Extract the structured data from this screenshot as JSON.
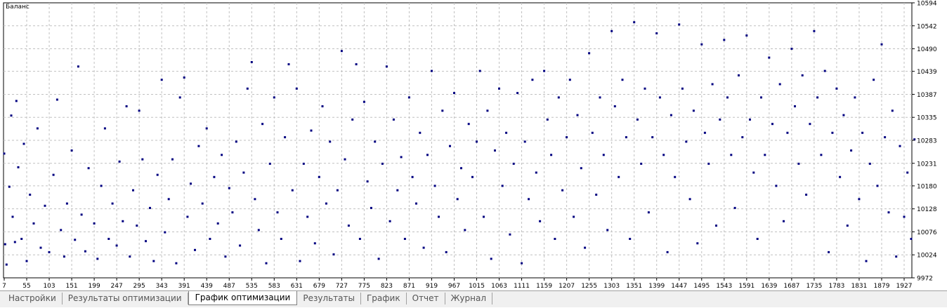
{
  "tabs": [
    {
      "label": "Настройки",
      "active": false
    },
    {
      "label": "Результаты оптимизации",
      "active": false
    },
    {
      "label": "График оптимизации",
      "active": true
    },
    {
      "label": "Результаты",
      "active": false
    },
    {
      "label": "График",
      "active": false
    },
    {
      "label": "Отчет",
      "active": false
    },
    {
      "label": "Журнал",
      "active": false
    }
  ],
  "chart_data": {
    "type": "scatter",
    "title": "Баланс",
    "xlabel": "",
    "ylabel": "",
    "xlim": [
      7,
      1951
    ],
    "ylim": [
      9972,
      10594
    ],
    "x_ticks": [
      7,
      55,
      103,
      151,
      199,
      247,
      295,
      343,
      391,
      439,
      487,
      535,
      583,
      631,
      679,
      727,
      775,
      823,
      871,
      919,
      967,
      1015,
      1063,
      1111,
      1159,
      1207,
      1255,
      1303,
      1351,
      1399,
      1447,
      1495,
      1543,
      1591,
      1639,
      1687,
      1735,
      1783,
      1831,
      1879,
      1927
    ],
    "y_ticks": [
      9972,
      10024,
      10076,
      10128,
      10180,
      10231,
      10283,
      10335,
      10387,
      10439,
      10490,
      10542,
      10594
    ],
    "grid": true,
    "point_count": 1944,
    "point_color": "#000080",
    "series": [
      {
        "name": "",
        "points": [
          [
            7,
            10253
          ],
          [
            9,
            10048
          ],
          [
            12,
            10002
          ],
          [
            18,
            10178
          ],
          [
            22,
            10339
          ],
          [
            25,
            10110
          ],
          [
            30,
            10053
          ],
          [
            33,
            10372
          ],
          [
            37,
            10222
          ],
          [
            44,
            10060
          ],
          [
            49,
            10275
          ],
          [
            55,
            10010
          ],
          [
            62,
            10160
          ],
          [
            70,
            10095
          ],
          [
            78,
            10310
          ],
          [
            85,
            10040
          ],
          [
            94,
            10135
          ],
          [
            103,
            10030
          ],
          [
            112,
            10205
          ],
          [
            120,
            10375
          ],
          [
            128,
            10080
          ],
          [
            135,
            10020
          ],
          [
            141,
            10140
          ],
          [
            151,
            10260
          ],
          [
            158,
            10058
          ],
          [
            165,
            10450
          ],
          [
            172,
            10115
          ],
          [
            180,
            10032
          ],
          [
            187,
            10220
          ],
          [
            199,
            10095
          ],
          [
            206,
            10015
          ],
          [
            214,
            10180
          ],
          [
            222,
            10310
          ],
          [
            230,
            10060
          ],
          [
            238,
            10140
          ],
          [
            247,
            10045
          ],
          [
            253,
            10235
          ],
          [
            260,
            10100
          ],
          [
            268,
            10360
          ],
          [
            275,
            10020
          ],
          [
            282,
            10170
          ],
          [
            290,
            10090
          ],
          [
            295,
            10350
          ],
          [
            302,
            10240
          ],
          [
            309,
            10055
          ],
          [
            318,
            10130
          ],
          [
            326,
            10010
          ],
          [
            334,
            10205
          ],
          [
            343,
            10420
          ],
          [
            350,
            10075
          ],
          [
            358,
            10150
          ],
          [
            366,
            10240
          ],
          [
            374,
            10005
          ],
          [
            382,
            10380
          ],
          [
            391,
            10425
          ],
          [
            398,
            10110
          ],
          [
            405,
            10185
          ],
          [
            414,
            10035
          ],
          [
            422,
            10270
          ],
          [
            430,
            10140
          ],
          [
            439,
            10310
          ],
          [
            446,
            10060
          ],
          [
            455,
            10200
          ],
          [
            463,
            10095
          ],
          [
            471,
            10250
          ],
          [
            479,
            10020
          ],
          [
            487,
            10175
          ],
          [
            494,
            10120
          ],
          [
            502,
            10280
          ],
          [
            510,
            10045
          ],
          [
            518,
            10210
          ],
          [
            526,
            10400
          ],
          [
            535,
            10460
          ],
          [
            542,
            10150
          ],
          [
            550,
            10080
          ],
          [
            558,
            10320
          ],
          [
            566,
            10005
          ],
          [
            574,
            10230
          ],
          [
            583,
            10380
          ],
          [
            590,
            10120
          ],
          [
            598,
            10060
          ],
          [
            606,
            10290
          ],
          [
            614,
            10455
          ],
          [
            622,
            10170
          ],
          [
            631,
            10400
          ],
          [
            638,
            10010
          ],
          [
            646,
            10230
          ],
          [
            654,
            10110
          ],
          [
            662,
            10305
          ],
          [
            670,
            10050
          ],
          [
            679,
            10200
          ],
          [
            686,
            10360
          ],
          [
            694,
            10140
          ],
          [
            702,
            10280
          ],
          [
            710,
            10025
          ],
          [
            718,
            10170
          ],
          [
            727,
            10485
          ],
          [
            734,
            10240
          ],
          [
            742,
            10090
          ],
          [
            750,
            10330
          ],
          [
            758,
            10455
          ],
          [
            766,
            10060
          ],
          [
            775,
            10370
          ],
          [
            782,
            10190
          ],
          [
            790,
            10130
          ],
          [
            798,
            10280
          ],
          [
            806,
            10015
          ],
          [
            814,
            10230
          ],
          [
            823,
            10450
          ],
          [
            830,
            10100
          ],
          [
            838,
            10330
          ],
          [
            846,
            10170
          ],
          [
            854,
            10245
          ],
          [
            862,
            10060
          ],
          [
            871,
            10380
          ],
          [
            878,
            10200
          ],
          [
            886,
            10140
          ],
          [
            894,
            10300
          ],
          [
            902,
            10040
          ],
          [
            910,
            10250
          ],
          [
            919,
            10440
          ],
          [
            926,
            10180
          ],
          [
            934,
            10110
          ],
          [
            942,
            10350
          ],
          [
            950,
            10030
          ],
          [
            958,
            10270
          ],
          [
            967,
            10390
          ],
          [
            974,
            10150
          ],
          [
            982,
            10220
          ],
          [
            990,
            10080
          ],
          [
            998,
            10320
          ],
          [
            1006,
            10200
          ],
          [
            1015,
            10280
          ],
          [
            1022,
            10440
          ],
          [
            1030,
            10110
          ],
          [
            1038,
            10350
          ],
          [
            1046,
            10015
          ],
          [
            1054,
            10260
          ],
          [
            1063,
            10400
          ],
          [
            1070,
            10180
          ],
          [
            1078,
            10300
          ],
          [
            1086,
            10070
          ],
          [
            1094,
            10230
          ],
          [
            1102,
            10390
          ],
          [
            1111,
            10005
          ],
          [
            1118,
            10280
          ],
          [
            1126,
            10150
          ],
          [
            1134,
            10420
          ],
          [
            1142,
            10210
          ],
          [
            1150,
            10100
          ],
          [
            1159,
            10440
          ],
          [
            1166,
            10330
          ],
          [
            1174,
            10250
          ],
          [
            1182,
            10060
          ],
          [
            1190,
            10380
          ],
          [
            1198,
            10170
          ],
          [
            1207,
            10290
          ],
          [
            1214,
            10420
          ],
          [
            1222,
            10110
          ],
          [
            1230,
            10340
          ],
          [
            1238,
            10220
          ],
          [
            1246,
            10040
          ],
          [
            1255,
            10480
          ],
          [
            1262,
            10300
          ],
          [
            1270,
            10160
          ],
          [
            1278,
            10380
          ],
          [
            1286,
            10250
          ],
          [
            1294,
            10080
          ],
          [
            1303,
            10530
          ],
          [
            1310,
            10360
          ],
          [
            1318,
            10200
          ],
          [
            1326,
            10420
          ],
          [
            1334,
            10290
          ],
          [
            1342,
            10060
          ],
          [
            1351,
            10550
          ],
          [
            1358,
            10330
          ],
          [
            1366,
            10230
          ],
          [
            1374,
            10400
          ],
          [
            1382,
            10120
          ],
          [
            1390,
            10290
          ],
          [
            1399,
            10525
          ],
          [
            1406,
            10380
          ],
          [
            1414,
            10250
          ],
          [
            1422,
            10030
          ],
          [
            1430,
            10340
          ],
          [
            1438,
            10200
          ],
          [
            1447,
            10545
          ],
          [
            1454,
            10400
          ],
          [
            1462,
            10280
          ],
          [
            1470,
            10150
          ],
          [
            1478,
            10350
          ],
          [
            1486,
            10050
          ],
          [
            1495,
            10500
          ],
          [
            1502,
            10300
          ],
          [
            1510,
            10230
          ],
          [
            1518,
            10410
          ],
          [
            1526,
            10090
          ],
          [
            1534,
            10330
          ],
          [
            1543,
            10510
          ],
          [
            1550,
            10380
          ],
          [
            1558,
            10250
          ],
          [
            1566,
            10130
          ],
          [
            1574,
            10430
          ],
          [
            1582,
            10290
          ],
          [
            1591,
            10520
          ],
          [
            1598,
            10330
          ],
          [
            1606,
            10210
          ],
          [
            1614,
            10060
          ],
          [
            1622,
            10380
          ],
          [
            1630,
            10250
          ],
          [
            1639,
            10470
          ],
          [
            1646,
            10320
          ],
          [
            1654,
            10180
          ],
          [
            1662,
            10410
          ],
          [
            1670,
            10100
          ],
          [
            1678,
            10300
          ],
          [
            1687,
            10490
          ],
          [
            1694,
            10360
          ],
          [
            1702,
            10230
          ],
          [
            1710,
            10430
          ],
          [
            1718,
            10160
          ],
          [
            1726,
            10320
          ],
          [
            1735,
            10530
          ],
          [
            1742,
            10380
          ],
          [
            1750,
            10250
          ],
          [
            1758,
            10440
          ],
          [
            1766,
            10030
          ],
          [
            1774,
            10300
          ],
          [
            1783,
            10400
          ],
          [
            1790,
            10200
          ],
          [
            1798,
            10340
          ],
          [
            1806,
            10090
          ],
          [
            1814,
            10260
          ],
          [
            1822,
            10380
          ],
          [
            1831,
            10150
          ],
          [
            1838,
            10300
          ],
          [
            1846,
            10010
          ],
          [
            1854,
            10230
          ],
          [
            1862,
            10420
          ],
          [
            1870,
            10180
          ],
          [
            1879,
            10500
          ],
          [
            1886,
            10290
          ],
          [
            1894,
            10120
          ],
          [
            1902,
            10350
          ],
          [
            1910,
            10020
          ],
          [
            1918,
            10270
          ],
          [
            1927,
            10110
          ],
          [
            1934,
            10210
          ],
          [
            1942,
            10060
          ],
          [
            1949,
            10285
          ]
        ]
      }
    ]
  }
}
